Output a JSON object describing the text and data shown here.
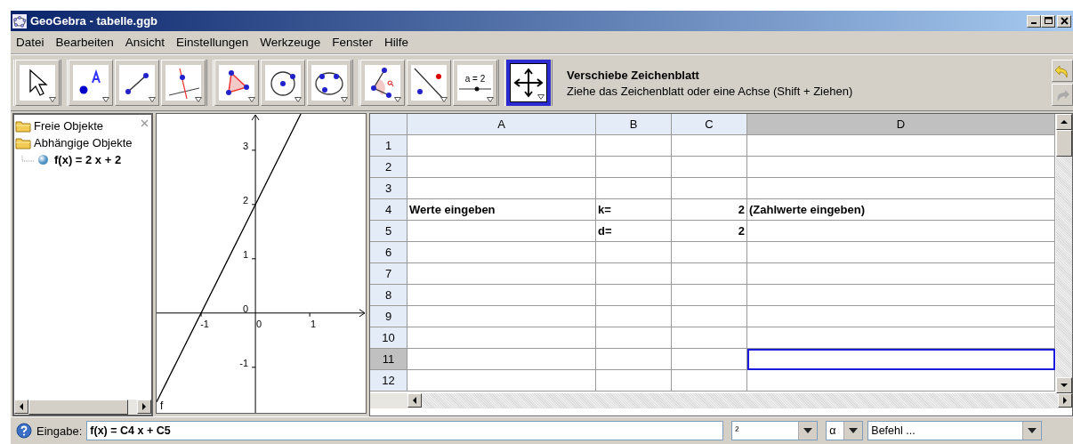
{
  "window": {
    "title": "GeoGebra - tabelle.ggb"
  },
  "menu": [
    "Datei",
    "Bearbeiten",
    "Ansicht",
    "Einstellungen",
    "Werkzeuge",
    "Fenster",
    "Hilfe"
  ],
  "toolbar": {
    "groups": [
      {
        "tools": [
          {
            "kind": "pointer",
            "selected": false
          }
        ]
      },
      {
        "tools": [
          {
            "kind": "point",
            "selected": false
          },
          {
            "kind": "segment",
            "selected": false
          },
          {
            "kind": "perpendicular",
            "selected": false
          }
        ]
      },
      {
        "tools": [
          {
            "kind": "polygon",
            "selected": false
          },
          {
            "kind": "circle",
            "selected": false
          },
          {
            "kind": "conic",
            "selected": false
          }
        ]
      },
      {
        "tools": [
          {
            "kind": "angle",
            "selected": false
          },
          {
            "kind": "reflect",
            "selected": false
          },
          {
            "kind": "slider",
            "label": "a = 2",
            "selected": false
          }
        ]
      },
      {
        "tools": [
          {
            "kind": "move",
            "selected": true
          }
        ]
      }
    ],
    "tool_title": "Verschiebe Zeichenblatt",
    "tool_help": "Ziehe das Zeichenblatt oder eine Achse (Shift + Ziehen)"
  },
  "algebra": {
    "items": [
      {
        "label": "Freie Objekte"
      },
      {
        "label": "Abhängige Objekte",
        "children": [
          {
            "label": "f(x) = 2 x + 2"
          }
        ]
      }
    ]
  },
  "graphics": {
    "chart_data": {
      "type": "line",
      "x": [
        -1.82,
        0.835
      ],
      "series": [
        {
          "name": "f",
          "color": "#000000",
          "values": [
            -1.64,
            3.67
          ]
        }
      ],
      "xlim": [
        -1.82,
        2.03
      ],
      "ylim": [
        -1.84,
        3.67
      ],
      "xticks": [
        -1,
        0,
        1
      ],
      "yticks": [
        -1,
        0,
        1,
        2,
        3
      ]
    }
  },
  "spreadsheet": {
    "columns": [
      {
        "label": "A",
        "selected": false
      },
      {
        "label": "B",
        "selected": false
      },
      {
        "label": "C",
        "selected": false
      },
      {
        "label": "D",
        "selected": true
      }
    ],
    "rows": [
      {
        "label": "1",
        "selected": false,
        "cells": [
          "",
          "",
          "",
          ""
        ]
      },
      {
        "label": "2",
        "selected": false,
        "cells": [
          "",
          "",
          "",
          ""
        ]
      },
      {
        "label": "3",
        "selected": false,
        "cells": [
          "",
          "",
          "",
          ""
        ]
      },
      {
        "label": "4",
        "selected": false,
        "cells": [
          "Werte eingeben",
          "k=",
          "2",
          "(Zahlwerte eingeben)"
        ]
      },
      {
        "label": "5",
        "selected": false,
        "cells": [
          "",
          "d=",
          "2",
          ""
        ]
      },
      {
        "label": "6",
        "selected": false,
        "cells": [
          "",
          "",
          "",
          ""
        ]
      },
      {
        "label": "7",
        "selected": false,
        "cells": [
          "",
          "",
          "",
          ""
        ]
      },
      {
        "label": "8",
        "selected": false,
        "cells": [
          "",
          "",
          "",
          ""
        ]
      },
      {
        "label": "9",
        "selected": false,
        "cells": [
          "",
          "",
          "",
          ""
        ]
      },
      {
        "label": "10",
        "selected": false,
        "cells": [
          "",
          "",
          "",
          ""
        ]
      },
      {
        "label": "11",
        "selected": true,
        "cells": [
          "",
          "",
          "",
          ""
        ]
      },
      {
        "label": "12",
        "selected": false,
        "cells": [
          "",
          "",
          "",
          ""
        ]
      }
    ]
  },
  "input_bar": {
    "label": "Eingabe:",
    "value": "f(x) = C4 x + C5",
    "symbols": "²",
    "greek": "α",
    "command": "Befehl ..."
  }
}
